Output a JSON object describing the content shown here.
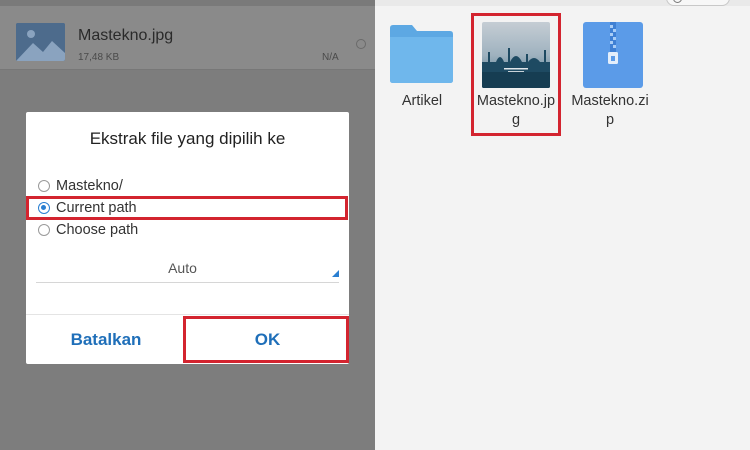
{
  "left_list": {
    "file_name": "Mastekno.jpg",
    "file_size": "17,48 KB",
    "file_date": "N/A"
  },
  "dialog": {
    "title": "Ekstrak file yang dipilih ke",
    "options": [
      {
        "label": "Mastekno/",
        "selected": false
      },
      {
        "label": "Current path",
        "selected": true
      },
      {
        "label": "Choose path",
        "selected": false
      }
    ],
    "encoding_select": {
      "value": "Auto"
    },
    "cancel_label": "Batalkan",
    "ok_label": "OK"
  },
  "right_grid": {
    "top_pill_text": "",
    "items": [
      {
        "label": "Artikel",
        "icon": "folder-icon"
      },
      {
        "label": "Mastekno.jpg",
        "icon": "image-thumbnail-icon"
      },
      {
        "label": "Mastekno.zip",
        "icon": "zip-icon"
      }
    ]
  },
  "colors": {
    "accent": "#2a7fd1",
    "button_text": "#1f6fb9",
    "highlight": "#d3242f",
    "folder": "#6bb3ea",
    "zip": "#5b9be8"
  }
}
